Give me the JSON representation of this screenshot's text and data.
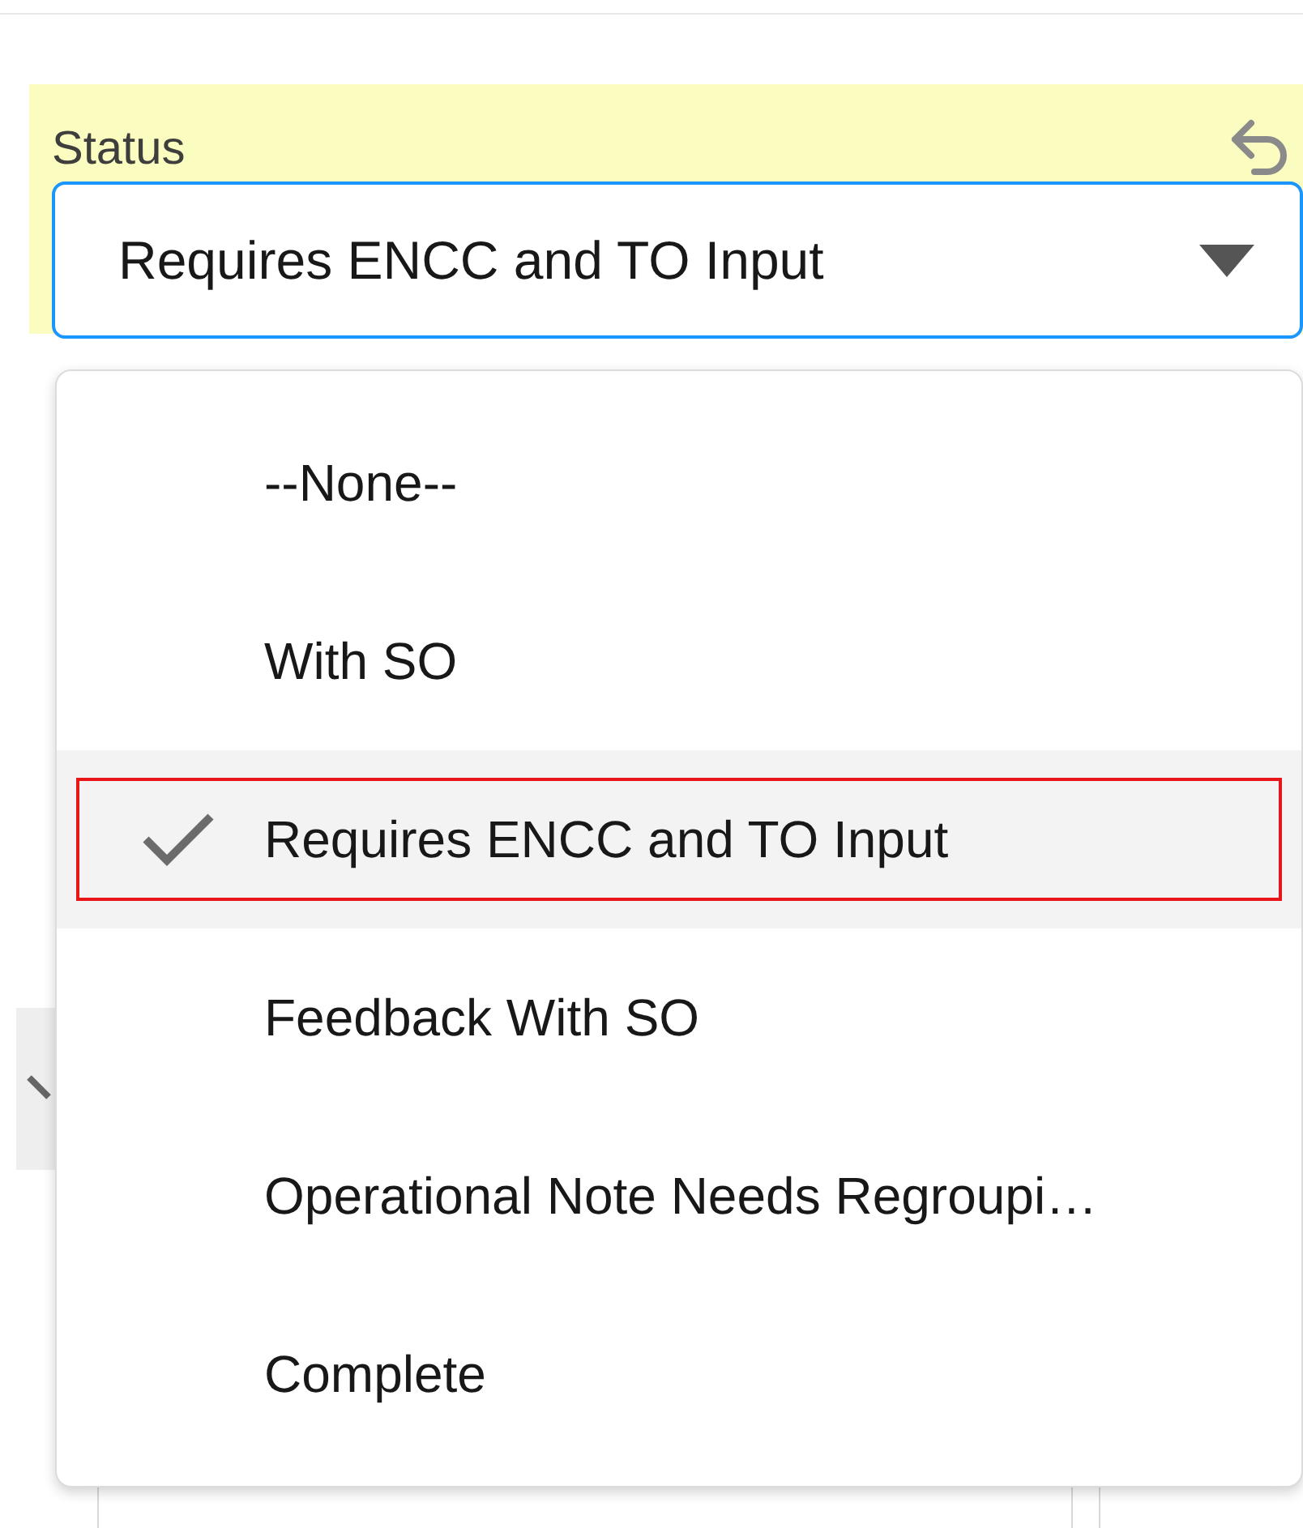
{
  "field": {
    "label": "Status",
    "value": "Requires ENCC and TO Input",
    "changed": true
  },
  "dropdown": {
    "options": [
      {
        "label": "--None--",
        "selected": false
      },
      {
        "label": "With SO",
        "selected": false
      },
      {
        "label": "Requires ENCC and TO Input",
        "selected": true
      },
      {
        "label": "Feedback With SO",
        "selected": false
      },
      {
        "label": "Operational Note Needs Regroupi…",
        "selected": false
      },
      {
        "label": "Complete",
        "selected": false
      }
    ]
  }
}
